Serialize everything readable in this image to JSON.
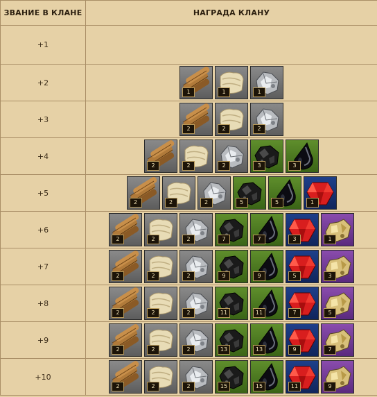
{
  "header": {
    "rank_col": "ЗВАНИЕ В КЛАНЕ",
    "reward_col": "НАГРАДА КЛАНУ"
  },
  "rows": [
    {
      "rank": "+1",
      "rewards": []
    },
    {
      "rank": "+2",
      "rewards": [
        {
          "icon": "wood-icon",
          "bg": "gray",
          "count": "1"
        },
        {
          "icon": "cloth-icon",
          "bg": "gray",
          "count": "1"
        },
        {
          "icon": "iron-ore-icon",
          "bg": "gray",
          "count": "1"
        }
      ]
    },
    {
      "rank": "+3",
      "rewards": [
        {
          "icon": "wood-icon",
          "bg": "gray",
          "count": "2"
        },
        {
          "icon": "cloth-icon",
          "bg": "gray",
          "count": "2"
        },
        {
          "icon": "iron-ore-icon",
          "bg": "gray",
          "count": "2"
        }
      ]
    },
    {
      "rank": "+4",
      "rewards": [
        {
          "icon": "wood-icon",
          "bg": "gray",
          "count": "2"
        },
        {
          "icon": "cloth-icon",
          "bg": "gray",
          "count": "2"
        },
        {
          "icon": "iron-ore-icon",
          "bg": "gray",
          "count": "2"
        },
        {
          "icon": "coal-icon",
          "bg": "green",
          "count": "3"
        },
        {
          "icon": "black-crystal-icon",
          "bg": "green",
          "count": "3"
        }
      ]
    },
    {
      "rank": "+5",
      "rewards": [
        {
          "icon": "wood-icon",
          "bg": "gray",
          "count": "2"
        },
        {
          "icon": "cloth-icon",
          "bg": "gray",
          "count": "2"
        },
        {
          "icon": "iron-ore-icon",
          "bg": "gray",
          "count": "2"
        },
        {
          "icon": "coal-icon",
          "bg": "green",
          "count": "5"
        },
        {
          "icon": "black-crystal-icon",
          "bg": "green",
          "count": "5"
        },
        {
          "icon": "ruby-icon",
          "bg": "blue",
          "count": "1"
        }
      ]
    },
    {
      "rank": "+6",
      "rewards": [
        {
          "icon": "wood-icon",
          "bg": "gray",
          "count": "2"
        },
        {
          "icon": "cloth-icon",
          "bg": "gray",
          "count": "2"
        },
        {
          "icon": "iron-ore-icon",
          "bg": "gray",
          "count": "2"
        },
        {
          "icon": "coal-icon",
          "bg": "green",
          "count": "7"
        },
        {
          "icon": "black-crystal-icon",
          "bg": "green",
          "count": "7"
        },
        {
          "icon": "ruby-icon",
          "bg": "blue",
          "count": "3"
        },
        {
          "icon": "gold-nugget-icon",
          "bg": "purple",
          "count": "1"
        }
      ]
    },
    {
      "rank": "+7",
      "rewards": [
        {
          "icon": "wood-icon",
          "bg": "gray",
          "count": "2"
        },
        {
          "icon": "cloth-icon",
          "bg": "gray",
          "count": "2"
        },
        {
          "icon": "iron-ore-icon",
          "bg": "gray",
          "count": "2"
        },
        {
          "icon": "coal-icon",
          "bg": "green",
          "count": "9"
        },
        {
          "icon": "black-crystal-icon",
          "bg": "green",
          "count": "9"
        },
        {
          "icon": "ruby-icon",
          "bg": "blue",
          "count": "5"
        },
        {
          "icon": "gold-nugget-icon",
          "bg": "purple",
          "count": "3"
        }
      ]
    },
    {
      "rank": "+8",
      "rewards": [
        {
          "icon": "wood-icon",
          "bg": "gray",
          "count": "2"
        },
        {
          "icon": "cloth-icon",
          "bg": "gray",
          "count": "2"
        },
        {
          "icon": "iron-ore-icon",
          "bg": "gray",
          "count": "2"
        },
        {
          "icon": "coal-icon",
          "bg": "green",
          "count": "11"
        },
        {
          "icon": "black-crystal-icon",
          "bg": "green",
          "count": "11"
        },
        {
          "icon": "ruby-icon",
          "bg": "blue",
          "count": "7"
        },
        {
          "icon": "gold-nugget-icon",
          "bg": "purple",
          "count": "5"
        }
      ]
    },
    {
      "rank": "+9",
      "rewards": [
        {
          "icon": "wood-icon",
          "bg": "gray",
          "count": "2"
        },
        {
          "icon": "cloth-icon",
          "bg": "gray",
          "count": "2"
        },
        {
          "icon": "iron-ore-icon",
          "bg": "gray",
          "count": "2"
        },
        {
          "icon": "coal-icon",
          "bg": "green",
          "count": "13"
        },
        {
          "icon": "black-crystal-icon",
          "bg": "green",
          "count": "13"
        },
        {
          "icon": "ruby-icon",
          "bg": "blue",
          "count": "9"
        },
        {
          "icon": "gold-nugget-icon",
          "bg": "purple",
          "count": "7"
        }
      ]
    },
    {
      "rank": "+10",
      "rewards": [
        {
          "icon": "wood-icon",
          "bg": "gray",
          "count": "2"
        },
        {
          "icon": "cloth-icon",
          "bg": "gray",
          "count": "2"
        },
        {
          "icon": "iron-ore-icon",
          "bg": "gray",
          "count": "2"
        },
        {
          "icon": "coal-icon",
          "bg": "green",
          "count": "15"
        },
        {
          "icon": "black-crystal-icon",
          "bg": "green",
          "count": "15"
        },
        {
          "icon": "ruby-icon",
          "bg": "blue",
          "count": "11"
        },
        {
          "icon": "gold-nugget-icon",
          "bg": "purple",
          "count": "9"
        }
      ]
    }
  ]
}
